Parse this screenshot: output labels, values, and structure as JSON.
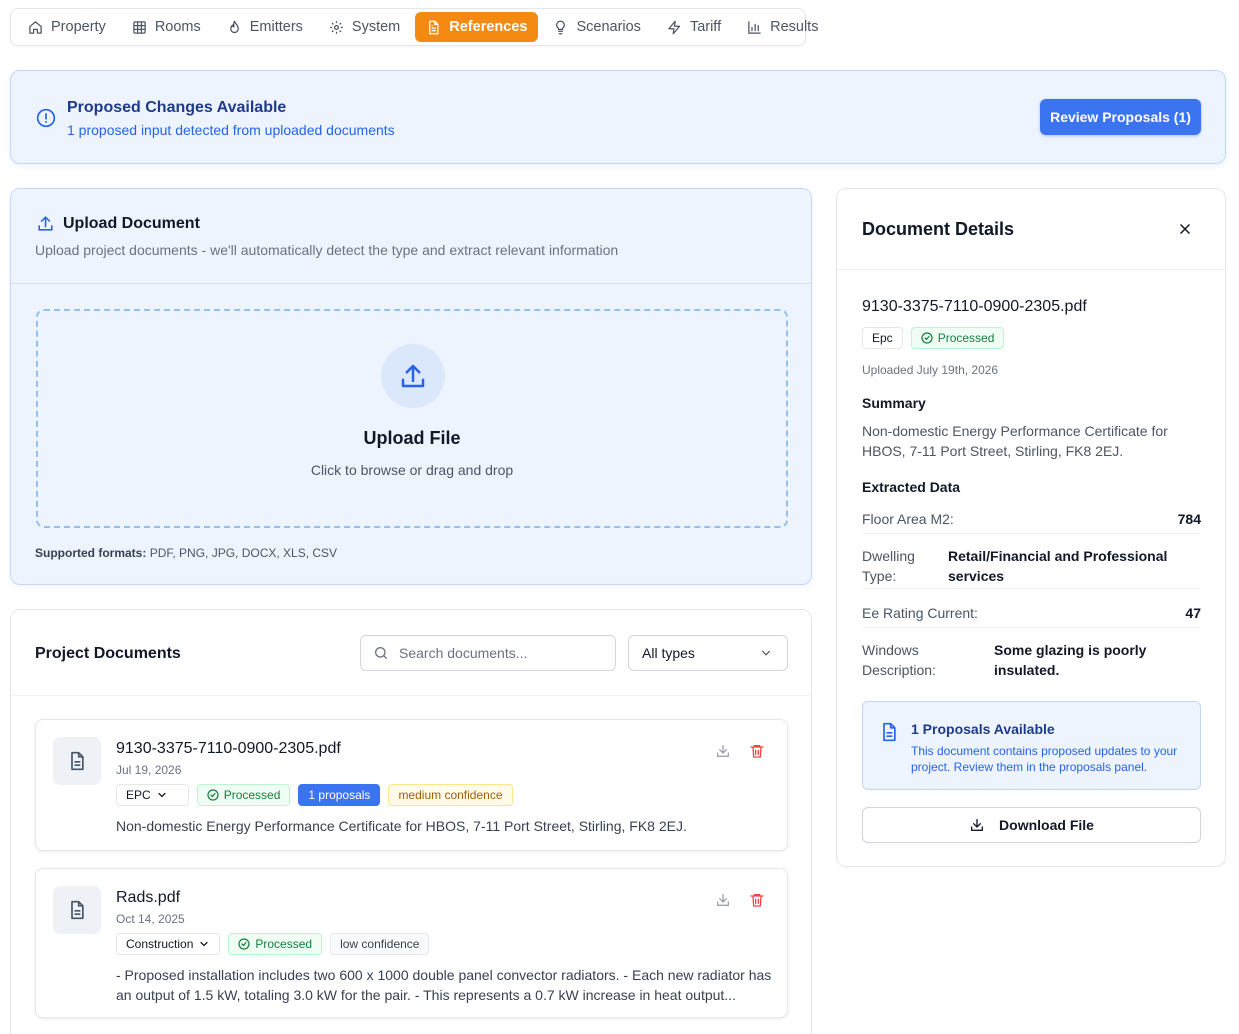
{
  "tabs": [
    {
      "label": "Property",
      "icon": "home-icon"
    },
    {
      "label": "Rooms",
      "icon": "grid-icon"
    },
    {
      "label": "Emitters",
      "icon": "flame-icon"
    },
    {
      "label": "System",
      "icon": "gear-icon"
    },
    {
      "label": "References",
      "icon": "document-icon",
      "active": true
    },
    {
      "label": "Scenarios",
      "icon": "lightbulb-icon"
    },
    {
      "label": "Tariff",
      "icon": "zap-icon"
    },
    {
      "label": "Results",
      "icon": "bar-chart-icon"
    }
  ],
  "banner": {
    "title": "Proposed Changes Available",
    "subtitle": "1 proposed input detected from uploaded documents",
    "button": "Review Proposals (1)"
  },
  "upload": {
    "title": "Upload Document",
    "subtitle": "Upload project documents - we'll automatically detect the type and extract relevant information",
    "drop_title": "Upload File",
    "drop_subtitle": "Click to browse or drag and drop",
    "formats_label": "Supported formats:",
    "formats": "PDF, PNG, JPG, DOCX, XLS, CSV"
  },
  "documents": {
    "title": "Project Documents",
    "search_placeholder": "Search documents...",
    "filter": "All types",
    "items": [
      {
        "name": "9130-3375-7110-0900-2305.pdf",
        "date": "Jul 19, 2026",
        "type": "EPC",
        "status": "Processed",
        "proposals": "1 proposals",
        "confidence": "medium confidence",
        "description": "Non-domestic Energy Performance Certificate for HBOS, 7-11 Port Street, Stirling, FK8 2EJ."
      },
      {
        "name": "Rads.pdf",
        "date": "Oct 14, 2025",
        "type": "Construction",
        "status": "Processed",
        "confidence": "low confidence",
        "description": "- Proposed installation includes two 600 x 1000 double panel convector radiators. - Each new radiator has an output of 1.5 kW, totaling 3.0 kW for the pair. - This represents a 0.7 kW increase in heat output..."
      }
    ]
  },
  "details": {
    "title": "Document Details",
    "file": "9130-3375-7110-0900-2305.pdf",
    "type": "Epc",
    "status": "Processed",
    "uploaded": "Uploaded July 19th, 2026",
    "summary_heading": "Summary",
    "summary": "Non-domestic Energy Performance Certificate for HBOS, 7-11 Port Street, Stirling, FK8 2EJ.",
    "extracted_heading": "Extracted Data",
    "fields": [
      {
        "key": "Floor Area M2:",
        "value": "784"
      },
      {
        "key": "Dwelling Type:",
        "value": "Retail/Financial and Professional services"
      },
      {
        "key": "Ee Rating Current:",
        "value": "47"
      },
      {
        "key": "Windows Description:",
        "value": "Some glazing is poorly insulated."
      }
    ],
    "proposals_title": "1 Proposals Available",
    "proposals_text": "This document contains proposed updates to your project. Review them in the proposals panel.",
    "download": "Download File"
  }
}
